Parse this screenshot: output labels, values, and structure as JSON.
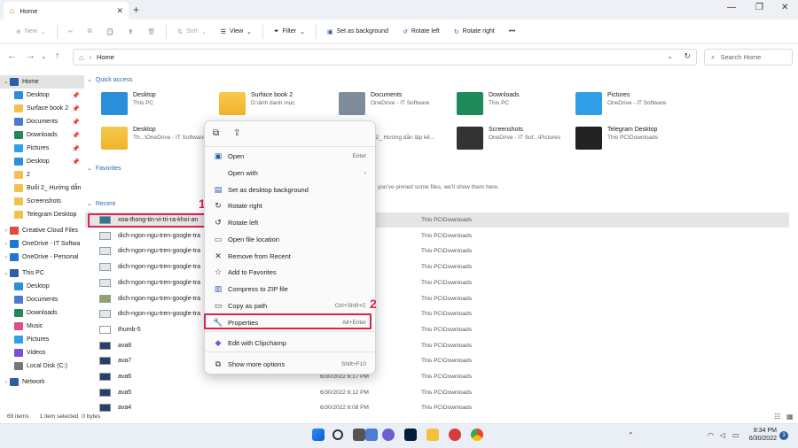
{
  "window": {
    "tab_title": "Home"
  },
  "toolbar": {
    "new": "New",
    "sort": "Sort",
    "view": "View",
    "filter": "Filter",
    "set_background": "Set as background",
    "rotate_left": "Rotate left",
    "rotate_right": "Rotate right",
    "more": "•••"
  },
  "address": {
    "path": "Home",
    "search_placeholder": "Search Home"
  },
  "sidebar": [
    {
      "label": "Home",
      "level": 0
    },
    {
      "label": "Desktop",
      "level": 1
    },
    {
      "label": "Surface book 2",
      "level": 1
    },
    {
      "label": "Documents",
      "level": 1
    },
    {
      "label": "Downloads",
      "level": 1
    },
    {
      "label": "Pictures",
      "level": 1
    },
    {
      "label": "Desktop",
      "level": 1
    },
    {
      "label": "2",
      "level": 1
    },
    {
      "label": "Buổi 2_ Hướng dẫn",
      "level": 1
    },
    {
      "label": "Screenshots",
      "level": 1
    },
    {
      "label": "Telegram Desktop",
      "level": 1
    },
    {
      "label": "Creative Cloud Files",
      "level": 0
    },
    {
      "label": "OneDrive - IT Softwa",
      "level": 0
    },
    {
      "label": "OneDrive - Personal",
      "level": 0
    },
    {
      "label": "This PC",
      "level": 0
    },
    {
      "label": "Desktop",
      "level": 1
    },
    {
      "label": "Documents",
      "level": 1
    },
    {
      "label": "Downloads",
      "level": 1
    },
    {
      "label": "Music",
      "level": 1
    },
    {
      "label": "Pictures",
      "level": 1
    },
    {
      "label": "Videos",
      "level": 1
    },
    {
      "label": "Local Disk (C:)",
      "level": 1
    },
    {
      "label": "Network",
      "level": 0
    }
  ],
  "sections": {
    "quick_access": "Quick access",
    "favorites": "Favorites",
    "favorites_hint": "you've pinned some files, we'll show them here.",
    "recent": "Recent"
  },
  "quick_access": [
    {
      "name": "Desktop",
      "sub": "This PC"
    },
    {
      "name": "Surface book 2",
      "sub": "D:\\ảnh danh mục"
    },
    {
      "name": "Documents",
      "sub": "OneDrive - IT Software"
    },
    {
      "name": "Downloads",
      "sub": "This PC"
    },
    {
      "name": "Pictures",
      "sub": "OneDrive - IT Software"
    },
    {
      "name": "Desktop",
      "sub": "Th...\\OneDrive - IT Software"
    },
    {
      "name": "2",
      "sub": "...2_ Hướng dẫn lập kế..."
    },
    {
      "name": "Screenshots",
      "sub": "OneDrive - IT Sof...\\Pictures"
    },
    {
      "name": "Telegram Desktop",
      "sub": "This PC\\Downloads"
    }
  ],
  "qa_extra": {
    "buoi": "...i 2_ Hướng dẫn lập kế..."
  },
  "recent": [
    {
      "name": "xoa-thong-tin-vi-tri-ra-khoi-an",
      "date": "",
      "loc": "This PC\\Downloads"
    },
    {
      "name": "dich-ngon-ngu-tren-google-tra",
      "date": "",
      "loc": "This PC\\Downloads"
    },
    {
      "name": "dich-ngon-ngu-tren-google-tra",
      "date": "",
      "loc": "This PC\\Downloads"
    },
    {
      "name": "dich-ngon-ngu-tren-google-tra",
      "date": "",
      "loc": "This PC\\Downloads"
    },
    {
      "name": "dich-ngon-ngu-tren-google-tra",
      "date": "",
      "loc": "This PC\\Downloads"
    },
    {
      "name": "dich-ngon-ngu-tren-google-tra",
      "date": "",
      "loc": "This PC\\Downloads"
    },
    {
      "name": "dich-ngon-ngu-tren-google-tra",
      "date": "",
      "loc": "This PC\\Downloads"
    },
    {
      "name": "thumb-5",
      "date": "",
      "loc": "This PC\\Downloads"
    },
    {
      "name": "ava8",
      "date": "",
      "loc": "This PC\\Downloads"
    },
    {
      "name": "ava7",
      "date": "",
      "loc": "This PC\\Downloads"
    },
    {
      "name": "ava6",
      "date": "6/30/2022 6:17 PM",
      "loc": "This PC\\Downloads"
    },
    {
      "name": "ava5",
      "date": "6/30/2022 6:12 PM",
      "loc": "This PC\\Downloads"
    },
    {
      "name": "ava4",
      "date": "6/30/2022 6:08 PM",
      "loc": "This PC\\Downloads"
    }
  ],
  "context_menu": [
    {
      "label": "Open",
      "shortcut": "Enter",
      "icon": "open-icon"
    },
    {
      "label": "Open with",
      "shortcut": "›",
      "icon": "open-with-icon"
    },
    {
      "label": "Set as desktop background",
      "shortcut": "",
      "icon": "wallpaper-icon"
    },
    {
      "label": "Rotate right",
      "shortcut": "",
      "icon": "rotate-right-icon"
    },
    {
      "label": "Rotate left",
      "shortcut": "",
      "icon": "rotate-left-icon"
    },
    {
      "label": "Open file location",
      "shortcut": "",
      "icon": "folder-icon"
    },
    {
      "label": "Remove from Recent",
      "shortcut": "",
      "icon": "close-icon"
    },
    {
      "label": "Add to Favorites",
      "shortcut": "",
      "icon": "star-icon"
    },
    {
      "label": "Compress to ZIP file",
      "shortcut": "",
      "icon": "zip-icon"
    },
    {
      "label": "Copy as path",
      "shortcut": "Ctrl+Shift+C",
      "icon": "path-icon"
    },
    {
      "label": "Properties",
      "shortcut": "Alt+Enter",
      "icon": "wrench-icon"
    },
    {
      "label": "Edit with Clipchamp",
      "shortcut": "",
      "icon": "clipchamp-icon"
    },
    {
      "label": "Show more options",
      "shortcut": "Shift+F10",
      "icon": "more-options-icon"
    }
  ],
  "annotations": {
    "one": "1",
    "two": "2"
  },
  "status": {
    "items": "69 items",
    "selected": "1 item selected",
    "size": "0 bytes"
  },
  "clock": {
    "time": "8:34 PM",
    "date": "6/30/2022",
    "badge": "3"
  },
  "colors": {
    "accent": "#0067c0",
    "highlight": "#e0224a"
  }
}
